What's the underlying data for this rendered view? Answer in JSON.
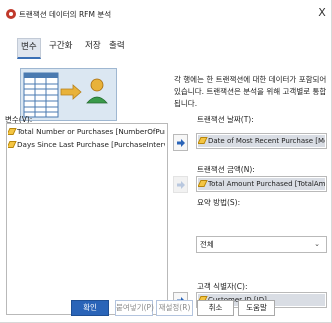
{
  "window": {
    "title": "트랜잭션 데이터의 RFM 분석",
    "close_label": "X"
  },
  "tabs": [
    {
      "label": "변수",
      "active": true
    },
    {
      "label": "구간화",
      "active": false
    },
    {
      "label": "저장",
      "active": false
    },
    {
      "label": "출력",
      "active": false
    }
  ],
  "description": "각 행에는 한 트랜잭션에 대한 데이터가 포함되어 있습니다. 트랜잭션은 분석을 위해 고객별로 통합됩니다.",
  "variables": {
    "label": "변수(V):",
    "items": [
      {
        "icon": "pencil-ruler-icon",
        "label": "Total Number or Purchases [NumberOfPurc..."
      },
      {
        "icon": "pencil-ruler-icon",
        "label": "Days Since Last Purchase [PurchaseInterval]"
      }
    ]
  },
  "transaction_date": {
    "label": "트랜잭션 날짜(T):",
    "value": "Date of Most Recent Purchase [Most..."
  },
  "transaction_amount": {
    "label": "트랜잭션 금액(N):",
    "value": "Total Amount Purchased [TotalAmount]"
  },
  "summary_method": {
    "label": "요약 방법(S):",
    "selected": "전체"
  },
  "customer_id": {
    "label": "고객 식별자(C):",
    "value": "Customer ID [ID]"
  },
  "buttons": {
    "ok": "확인",
    "paste": "붙여넣기(P)",
    "reset": "재설정(R)",
    "cancel": "취소",
    "help": "도움말"
  },
  "colors": {
    "primary": "#2a64b8",
    "selected_field": "#d9dde4",
    "arrow": "#2a64b8"
  }
}
